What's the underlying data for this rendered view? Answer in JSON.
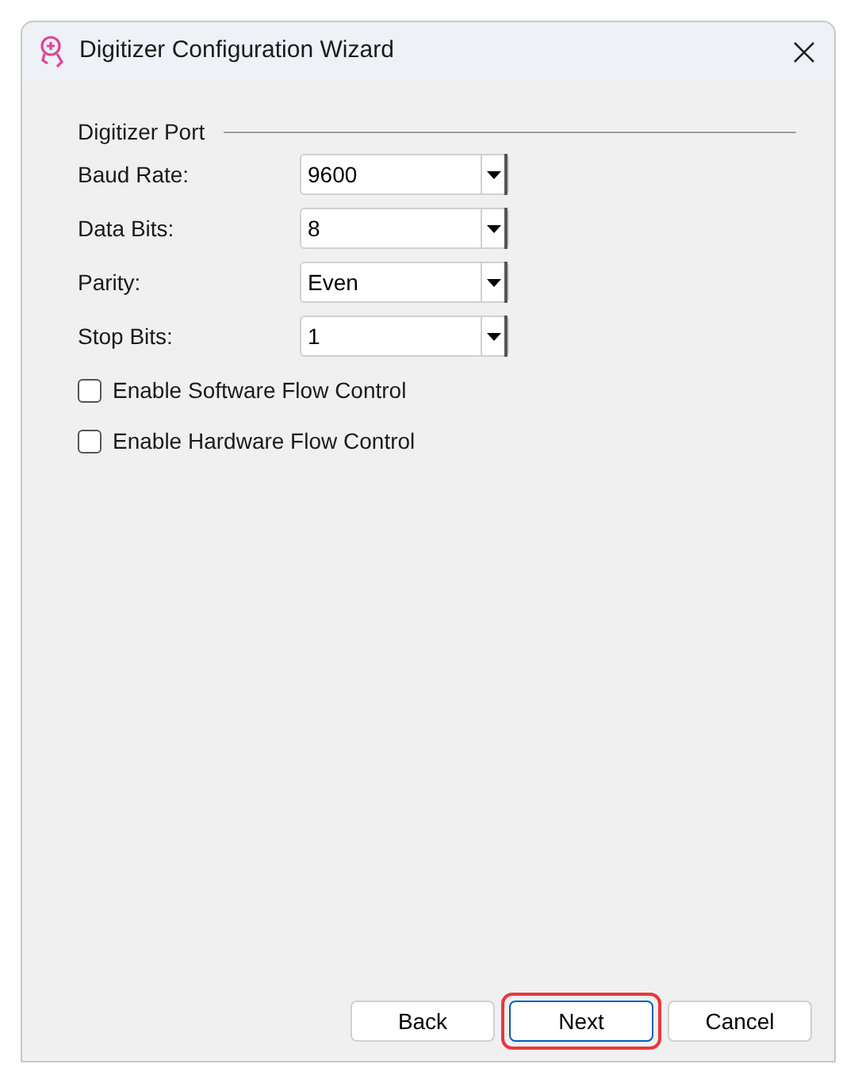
{
  "window": {
    "title": "Digitizer Configuration Wizard"
  },
  "group": {
    "title": "Digitizer Port"
  },
  "fields": [
    {
      "label": "Baud Rate:",
      "value": "9600"
    },
    {
      "label": "Data Bits:",
      "value": "8"
    },
    {
      "label": "Parity:",
      "value": "Even"
    },
    {
      "label": "Stop Bits:",
      "value": "1"
    }
  ],
  "checkboxes": [
    {
      "label": "Enable Software Flow Control",
      "checked": false
    },
    {
      "label": "Enable Hardware Flow Control",
      "checked": false
    }
  ],
  "buttons": [
    {
      "label": "Back",
      "focused": false,
      "highlighted": false
    },
    {
      "label": "Next",
      "focused": true,
      "highlighted": true
    },
    {
      "label": "Cancel",
      "focused": false,
      "highlighted": false
    }
  ]
}
